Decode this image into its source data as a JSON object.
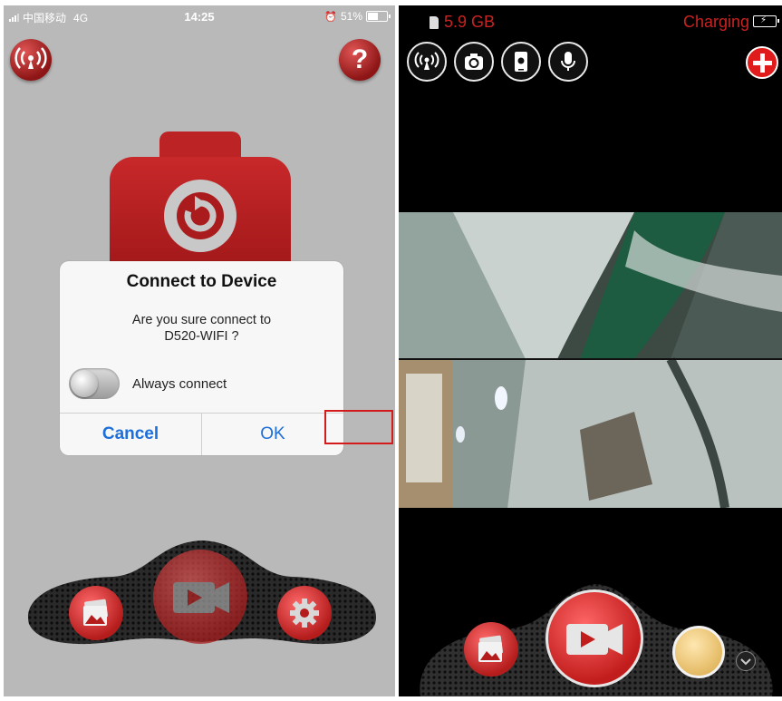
{
  "left_screen": {
    "status_bar": {
      "carrier": "中国移动",
      "network": "4G",
      "time": "14:25",
      "battery": "51%",
      "battery_level": 0.51
    },
    "help_button_label": "?",
    "dialog": {
      "title": "Connect to Device",
      "message_line1": "Are you sure connect to",
      "message_line2": "D520-WIFI ?",
      "switch_label": "Always connect",
      "cancel_label": "Cancel",
      "ok_label": "OK"
    },
    "dock_icons": [
      "gallery-icon",
      "record-video-icon",
      "settings-icon"
    ]
  },
  "right_screen": {
    "storage": "5.9 GB",
    "charging": "Charging",
    "toolbar_icons": [
      "wifi-icon",
      "switch-camera-icon",
      "phone-screen-icon",
      "microphone-icon",
      "add-icon"
    ],
    "dock_icons": [
      "gallery-icon",
      "record-video-icon",
      "capture-icon",
      "chevron-down-icon"
    ]
  },
  "colors": {
    "accent_red": "#c0201f",
    "dialog_button_blue": "#1e6fd9",
    "left_background": "#b9b9b9",
    "right_background": "#000000",
    "highlight_box": "#d41b1b"
  }
}
